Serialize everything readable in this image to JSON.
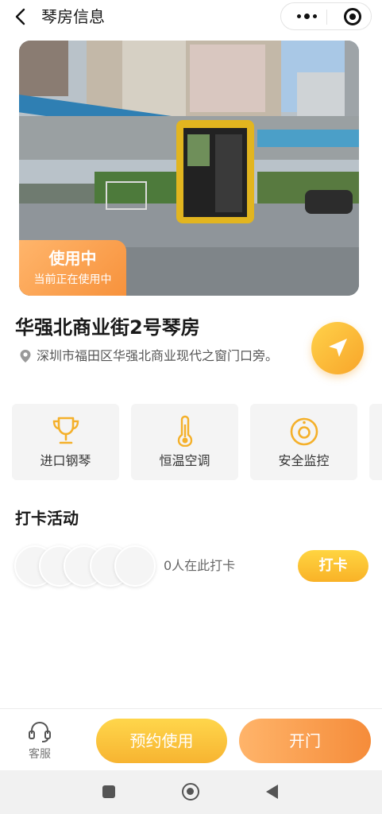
{
  "header": {
    "title": "琴房信息",
    "back_icon": "chevron-left-icon",
    "more_icon": "more-dots-icon",
    "close_icon": "mini-program-close-icon"
  },
  "hero": {
    "status_title": "使用中",
    "status_subtitle": "当前正在使用中",
    "status_color": "#F7923C"
  },
  "room": {
    "name": "华强北商业街2号琴房",
    "address": "深圳市福田区华强北商业现代之窗门口旁。",
    "pin_icon": "location-pin-icon",
    "navigate_icon": "navigation-arrow-icon"
  },
  "features": [
    {
      "label": "进口钢琴",
      "icon": "trophy-icon"
    },
    {
      "label": "恒温空调",
      "icon": "thermometer-icon"
    },
    {
      "label": "安全监控",
      "icon": "camera-icon"
    }
  ],
  "checkin": {
    "title": "打卡活动",
    "count_text": "0人在此打卡",
    "button": "打卡"
  },
  "bottom_bar": {
    "service_label": "客服",
    "service_icon": "headset-icon",
    "book_label": "预约使用",
    "open_label": "开门"
  },
  "colors": {
    "accent_yellow": "#F9B227",
    "accent_orange": "#F58C3A"
  }
}
